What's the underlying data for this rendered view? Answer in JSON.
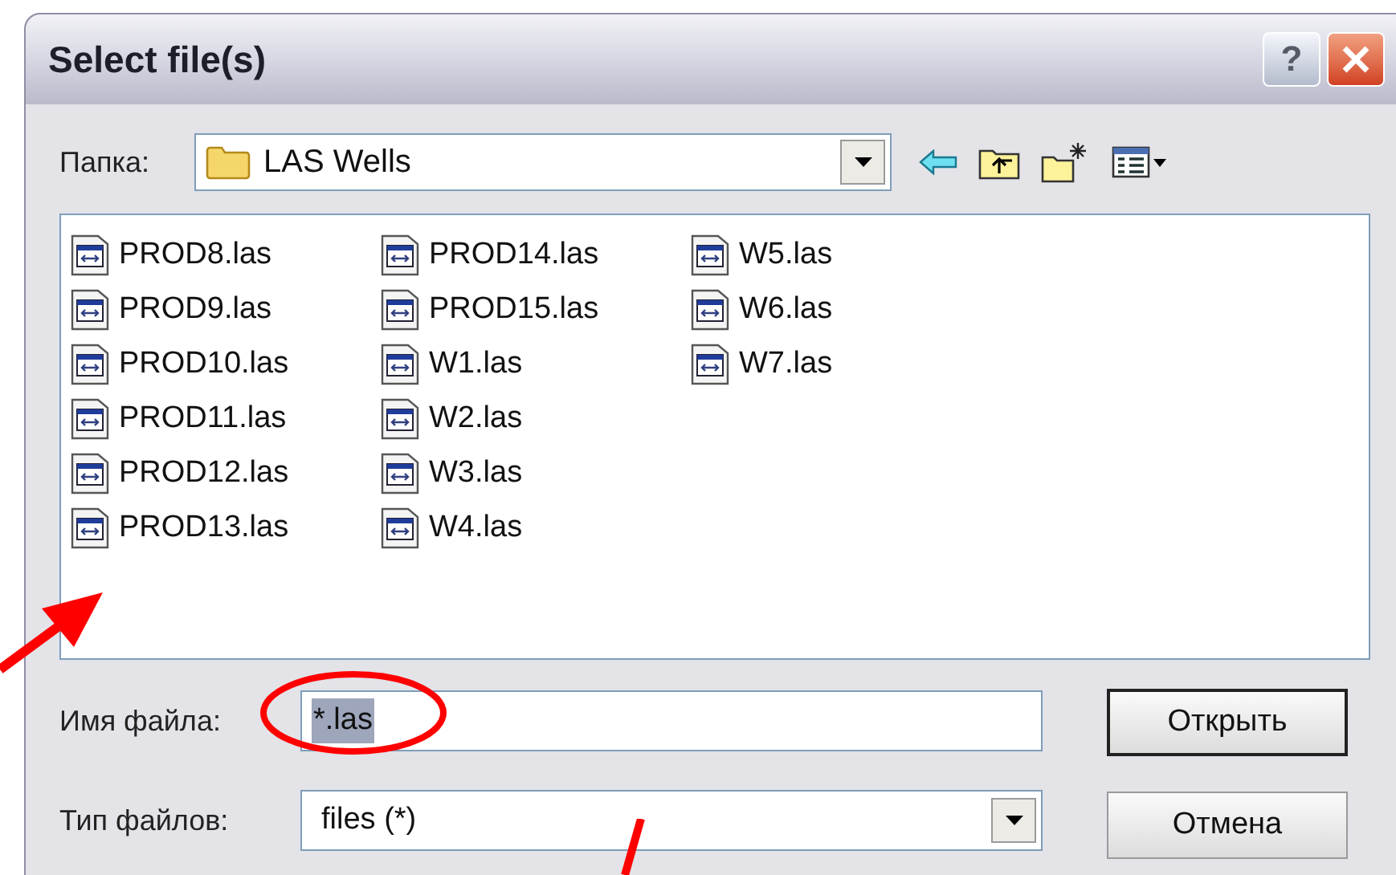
{
  "window": {
    "title": "Select file(s)"
  },
  "title_buttons": [
    {
      "kind": "help",
      "label": "?"
    },
    {
      "kind": "close"
    }
  ],
  "folder": {
    "label": "Папка:",
    "value": "LAS Wells"
  },
  "toolbar": [
    {
      "kind": "back"
    },
    {
      "kind": "up"
    },
    {
      "kind": "new-folder"
    },
    {
      "kind": "view"
    }
  ],
  "files": [
    {
      "name": "PROD8.las"
    },
    {
      "name": "PROD9.las"
    },
    {
      "name": "PROD10.las"
    },
    {
      "name": "PROD11.las"
    },
    {
      "name": "PROD12.las"
    },
    {
      "name": "PROD13.las"
    },
    {
      "name": "PROD14.las"
    },
    {
      "name": "PROD15.las"
    },
    {
      "name": "W1.las"
    },
    {
      "name": "W2.las"
    },
    {
      "name": "W3.las"
    },
    {
      "name": "W4.las"
    },
    {
      "name": "W5.las"
    },
    {
      "name": "W6.las"
    },
    {
      "name": "W7.las"
    }
  ],
  "file_name": {
    "label": "Имя файла:",
    "value": "*.las",
    "selected": true
  },
  "file_type": {
    "label": "Тип файлов:",
    "value": "files (*)"
  },
  "buttons": [
    {
      "label": "Открыть",
      "default": true
    },
    {
      "label": "Отмена",
      "default": false
    }
  ]
}
